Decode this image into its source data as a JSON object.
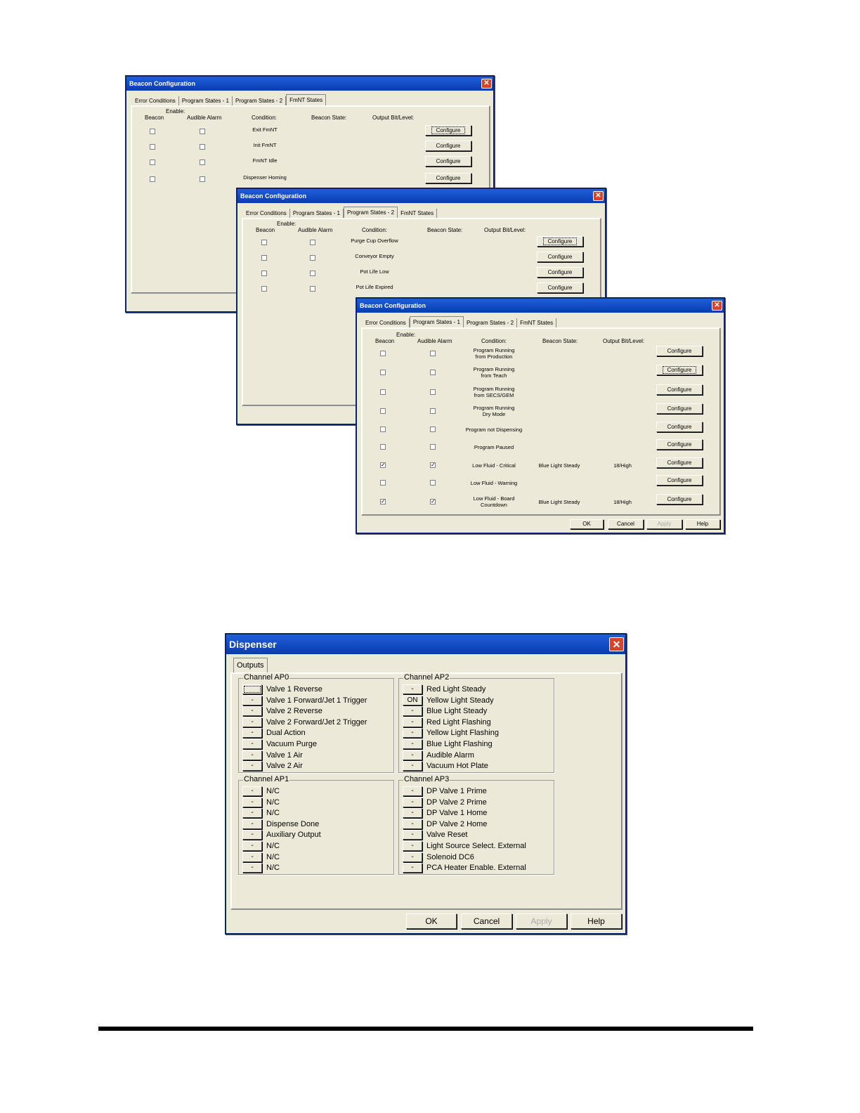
{
  "beacon_common": {
    "enable_label": "Enable:",
    "beacon_label": "Beacon",
    "audible_label": "Audible Alarm",
    "condition_label": "Condition:",
    "state_label": "Beacon State:",
    "output_label": "Output Bit/Level:",
    "configure": "Configure",
    "tab_labels": [
      "Error Conditions",
      "Program States - 1",
      "Program States - 2",
      "FmNT States"
    ]
  },
  "win1": {
    "title": "Beacon Configuration",
    "rows": [
      "Exit FmNT",
      "Init FmNT",
      "FmNT Idle",
      "Dispenser Homing"
    ]
  },
  "win2": {
    "title": "Beacon Configuration",
    "rows": [
      "Purge Cup Overflow",
      "Conveyor Empty",
      "Pot Life Low",
      "Pot Life Expired"
    ]
  },
  "win3": {
    "title": "Beacon Configuration",
    "rows": [
      {
        "c1": "Program Running",
        "c2": "from Production",
        "beacon": false,
        "audible": false,
        "state": "",
        "output": ""
      },
      {
        "c1": "Program Running",
        "c2": "from Teach",
        "beacon": false,
        "audible": false,
        "state": "",
        "output": ""
      },
      {
        "c1": "Program Running",
        "c2": "from SECS/GEM",
        "beacon": false,
        "audible": false,
        "state": "",
        "output": ""
      },
      {
        "c1": "Program Running",
        "c2": "Dry Mode",
        "beacon": false,
        "audible": false,
        "state": "",
        "output": ""
      },
      {
        "c1": "Program not Dispensing",
        "c2": "",
        "beacon": false,
        "audible": false,
        "state": "",
        "output": ""
      },
      {
        "c1": "Program Paused",
        "c2": "",
        "beacon": false,
        "audible": false,
        "state": "",
        "output": ""
      },
      {
        "c1": "Low Fluid - Critical",
        "c2": "",
        "beacon": true,
        "audible": true,
        "state": "Blue Light Steady",
        "output": "18/High"
      },
      {
        "c1": "Low Fluid - Warning",
        "c2": "",
        "beacon": false,
        "audible": false,
        "state": "",
        "output": ""
      },
      {
        "c1": "Low Fluid - Board",
        "c2": "Countdown",
        "beacon": true,
        "audible": true,
        "state": "Blue Light Steady",
        "output": "18/High"
      }
    ],
    "ok": "OK",
    "cancel": "Cancel",
    "apply": "Apply",
    "help": "Help"
  },
  "dispenser": {
    "title": "Dispenser",
    "tab": "Outputs",
    "channels": [
      {
        "name": "Channel AP0",
        "items": [
          {
            "b": "",
            "l": "Valve 1 Reverse"
          },
          {
            "b": "-",
            "l": "Valve 1 Forward/Jet 1 Trigger"
          },
          {
            "b": "-",
            "l": "Valve 2 Reverse"
          },
          {
            "b": "-",
            "l": "Valve 2 Forward/Jet 2 Trigger"
          },
          {
            "b": "-",
            "l": "Dual Action"
          },
          {
            "b": "-",
            "l": "Vacuum Purge"
          },
          {
            "b": "-",
            "l": "Valve 1 Air"
          },
          {
            "b": "-",
            "l": "Valve 2 Air"
          }
        ]
      },
      {
        "name": "Channel AP2",
        "items": [
          {
            "b": "-",
            "l": "Red Light Steady"
          },
          {
            "b": "ON",
            "l": "Yellow Light Steady"
          },
          {
            "b": "-",
            "l": "Blue Light Steady"
          },
          {
            "b": "-",
            "l": "Red Light Flashing"
          },
          {
            "b": "-",
            "l": "Yellow Light Flashing"
          },
          {
            "b": "-",
            "l": "Blue Light Flashing"
          },
          {
            "b": "-",
            "l": "Audible Alarm"
          },
          {
            "b": "-",
            "l": "Vacuum Hot Plate"
          }
        ]
      },
      {
        "name": "Channel AP1",
        "items": [
          {
            "b": "-",
            "l": "N/C"
          },
          {
            "b": "-",
            "l": "N/C"
          },
          {
            "b": "-",
            "l": "N/C"
          },
          {
            "b": "-",
            "l": "Dispense Done"
          },
          {
            "b": "-",
            "l": "Auxiliary Output"
          },
          {
            "b": "-",
            "l": "N/C"
          },
          {
            "b": "-",
            "l": "N/C"
          },
          {
            "b": "-",
            "l": "N/C"
          }
        ]
      },
      {
        "name": "Channel AP3",
        "items": [
          {
            "b": "-",
            "l": "DP Valve 1 Prime"
          },
          {
            "b": "-",
            "l": "DP Valve 2 Prime"
          },
          {
            "b": "-",
            "l": "DP Valve 1 Home"
          },
          {
            "b": "-",
            "l": "DP Valve 2 Home"
          },
          {
            "b": "-",
            "l": "Valve Reset"
          },
          {
            "b": "-",
            "l": "Light Source Select. External"
          },
          {
            "b": "-",
            "l": "Solenoid DC6"
          },
          {
            "b": "-",
            "l": "PCA Heater Enable. External"
          }
        ]
      }
    ],
    "ok": "OK",
    "cancel": "Cancel",
    "apply": "Apply",
    "help": "Help"
  }
}
